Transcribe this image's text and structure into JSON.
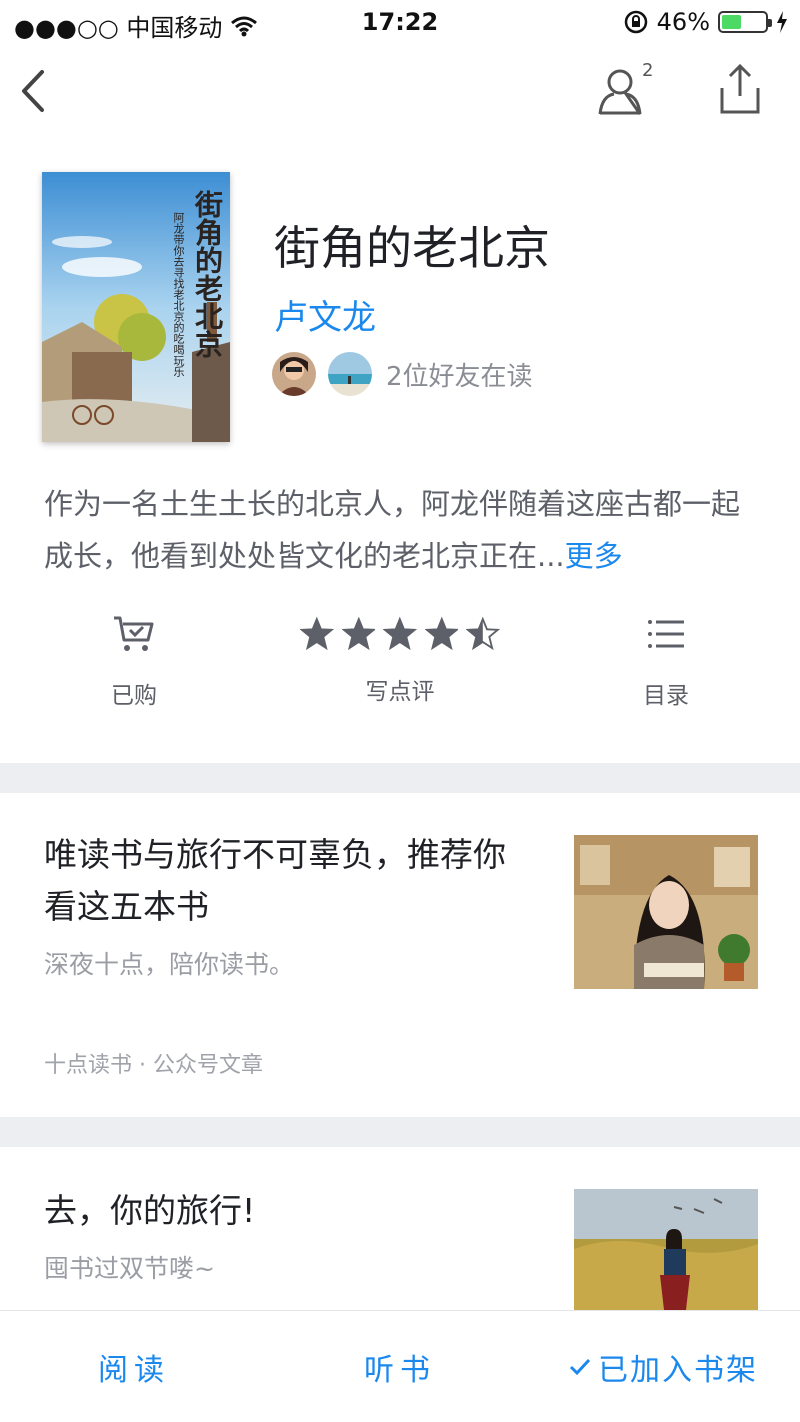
{
  "status": {
    "carrier": "●●●○○ 中国移动",
    "time": "17:22",
    "battery": "46%",
    "battery_level": 0.46
  },
  "nav": {
    "friends_badge": "2"
  },
  "book": {
    "title": "街角的老北京",
    "author": "卢文龙",
    "friends_reading": "2位好友在读",
    "intro": "作为一名土生土长的北京人，阿龙伴随着这座古都一起成长，他看到处处皆文化的老北京正在...",
    "intro_more": "更多",
    "cover_title_vertical": "街角的老北京",
    "cover_subtitle": "阿龙带你去寻找老北京的吃喝玩乐",
    "rating": 4.5
  },
  "actions": {
    "bought": "已购",
    "review": "写点评",
    "toc": "目录"
  },
  "articles": [
    {
      "title": "唯读书与旅行不可辜负，推荐你看这五本书",
      "subtitle": "深夜十点，陪你读书。",
      "source": "十点读书 · 公众号文章"
    },
    {
      "title": "去，你的旅行!",
      "subtitle": "囤书过双节喽~"
    }
  ],
  "bottom": {
    "read": "阅读",
    "listen": "听书",
    "shelf": "已加入书架"
  },
  "colors": {
    "accent": "#1b88ee",
    "icon": "#5d6068",
    "divider": "#eceef1"
  }
}
